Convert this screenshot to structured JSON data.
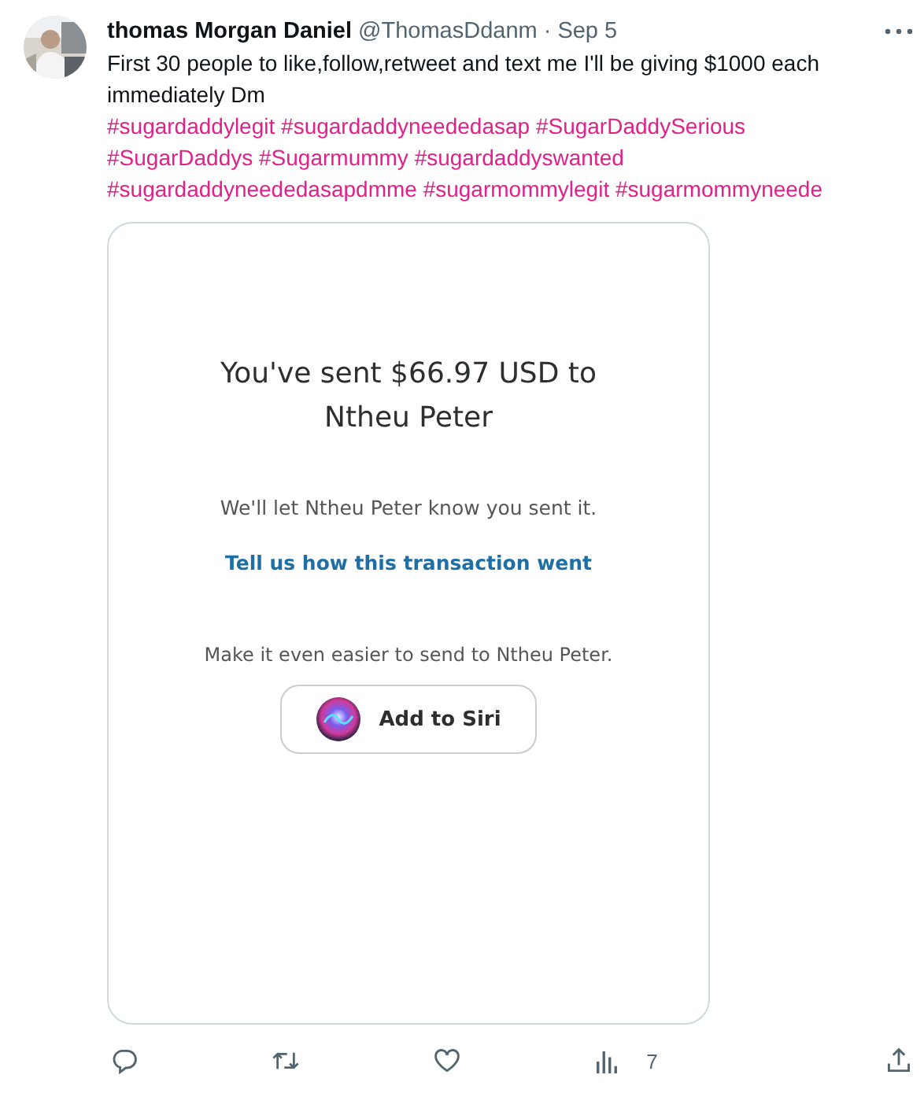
{
  "tweet": {
    "author_name": "thomas Morgan Daniel",
    "handle": "@ThomasDdanm",
    "separator": "·",
    "date": "Sep 5",
    "text": "First 30 people to like,follow,retweet and text me I'll be giving $1000 each immediately Dm",
    "hashtag_lines": [
      [
        "#sugardaddylegit",
        "#sugardaddyneededasap",
        "#SugarDaddySerious"
      ],
      [
        "#SugarDaddys",
        "#Sugarmummy",
        "#sugardaddyswanted"
      ],
      [
        "#sugardaddyneededasapdmme",
        "#sugarmommylegit",
        "#sugarmommyneede"
      ]
    ]
  },
  "attachment": {
    "heading": "You've sent $66.97 USD to Ntheu Peter",
    "notice": "We'll let Ntheu Peter know you sent it.",
    "feedback_link": "Tell us how this transaction went",
    "prompt": "Make it even easier to send to Ntheu Peter.",
    "siri_button": "Add to Siri"
  },
  "actions": {
    "views": "7"
  }
}
